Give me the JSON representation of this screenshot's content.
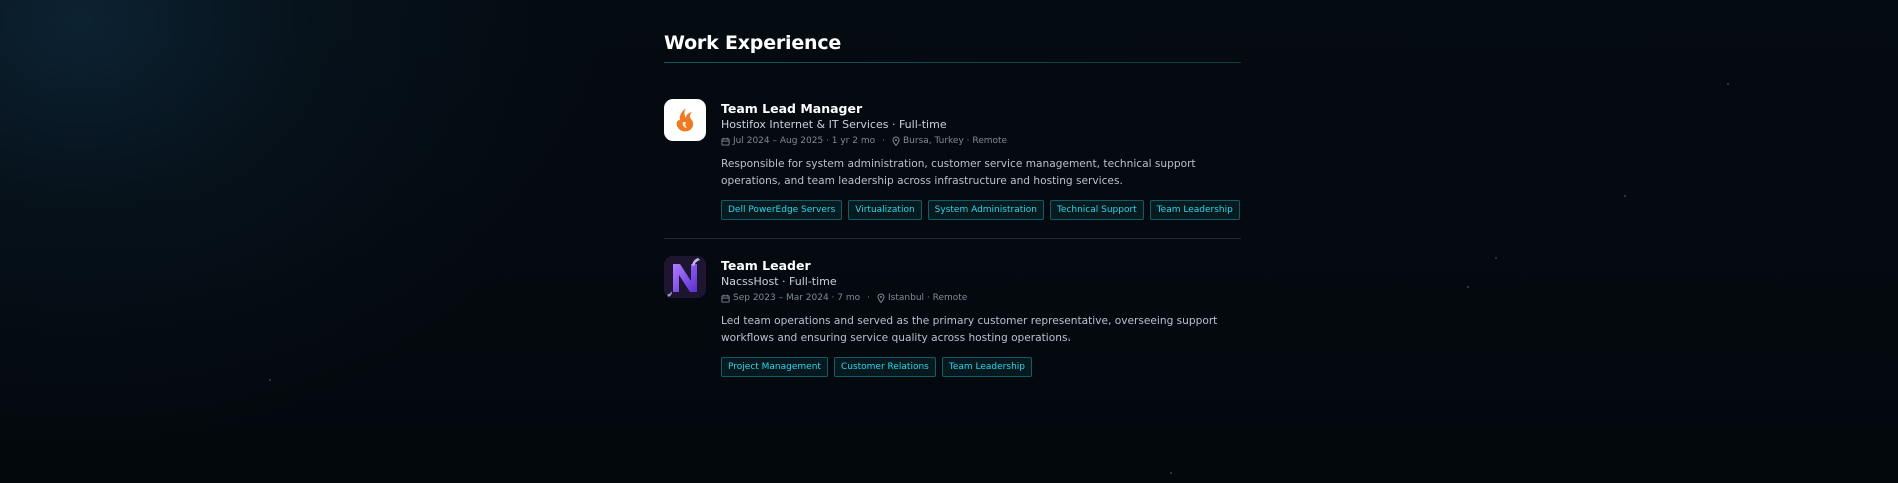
{
  "section": {
    "title": "Work Experience"
  },
  "jobs": [
    {
      "role": "Team Lead Manager",
      "company": "Hostifox Internet & IT Services · Full-time",
      "dates": "Jul 2024 – Aug 2025 · 1 yr 2 mo",
      "location": "Bursa, Turkey · Remote",
      "description": "Responsible for system administration, customer service management, technical support operations, and team leadership across infrastructure and hosting services.",
      "tags": [
        "Dell PowerEdge Servers",
        "Virtualization",
        "System Administration",
        "Technical Support",
        "Team Leadership"
      ],
      "logo_icon": "fox-flame-logo-icon",
      "logo_color": "#f07a22"
    },
    {
      "role": "Team Leader",
      "company": "NacssHost · Full-time",
      "dates": "Sep 2023 – Mar 2024 · 7 mo",
      "location": "Istanbul · Remote",
      "description": "Led team operations and served as the primary customer representative, overseeing support workflows and ensuring service quality across hosting operations.",
      "tags": [
        "Project Management",
        "Customer Relations",
        "Team Leadership"
      ],
      "logo_icon": "purple-n-logo-icon",
      "logo_color": "#8a5cf6"
    }
  ],
  "colors": {
    "accent": "#2fd4e8",
    "background": "#03080d"
  }
}
